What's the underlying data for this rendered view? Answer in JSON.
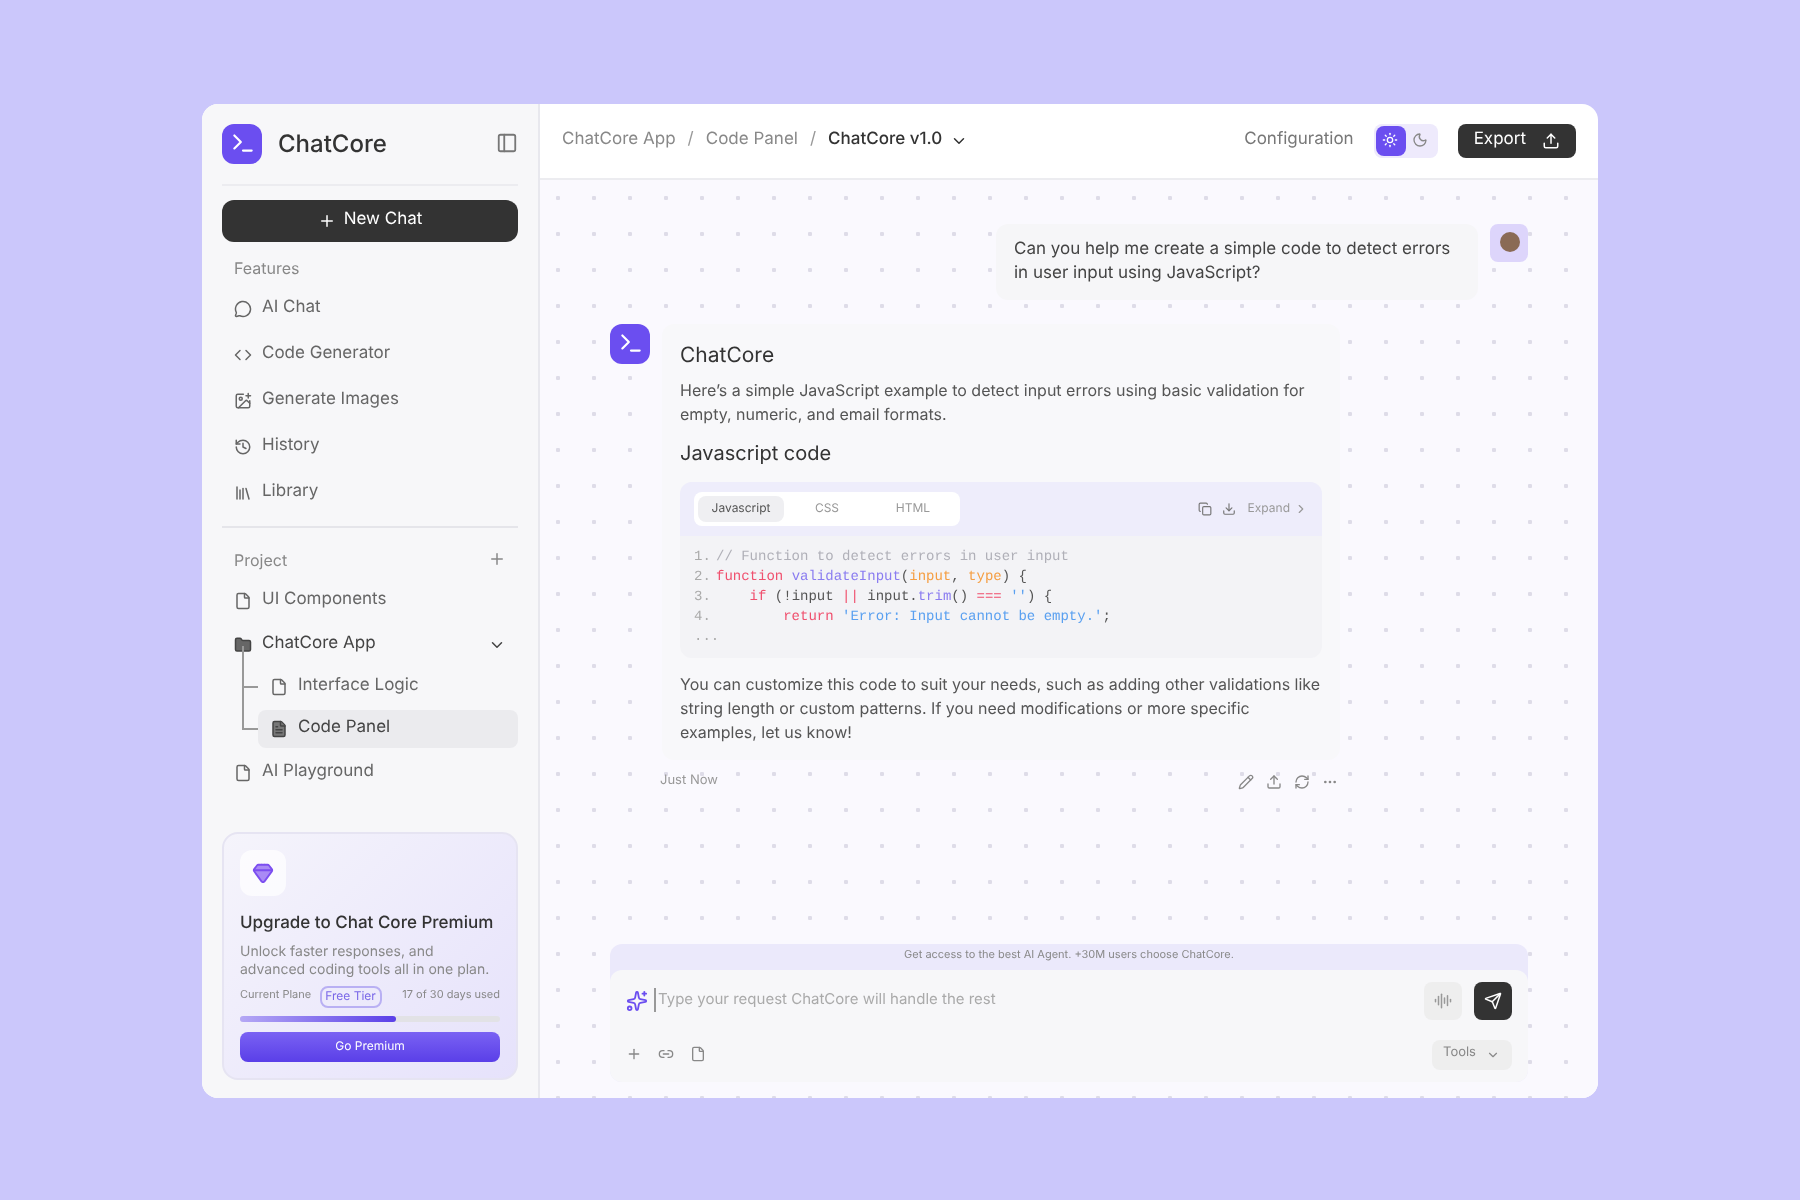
{
  "sidebar": {
    "brand": "ChatCore",
    "new_chat": "New Chat",
    "features_label": "Features",
    "features": [
      {
        "label": "AI Chat"
      },
      {
        "label": "Code Generator"
      },
      {
        "label": "Generate Images"
      },
      {
        "label": "History"
      },
      {
        "label": "Library"
      }
    ],
    "project_label": "Project",
    "projects": [
      {
        "label": "UI Components",
        "selected": false,
        "expanded": false
      },
      {
        "label": "ChatCore App",
        "selected": false,
        "expanded": true,
        "children": [
          {
            "label": "Interface Logic",
            "selected": false
          },
          {
            "label": "Code Panel",
            "selected": true
          }
        ]
      },
      {
        "label": "AI Playground",
        "selected": false,
        "expanded": false
      }
    ],
    "upgrade": {
      "title": "Upgrade to Chat Core Premium",
      "text": "Unlock faster responses, and advanced coding tools all in one plan.",
      "plan_label": "Current Plane",
      "plan": "Free Tier",
      "usage": "17 of 30 days used",
      "level": 0.6,
      "button": "Go Premium"
    }
  },
  "header": {
    "breadcrumbs": [
      "ChatCore App",
      "Code Panel",
      "ChatCore v1.0"
    ],
    "separators": [
      "/",
      "/"
    ],
    "config": "Configuration",
    "theme": [
      {
        "kind": "light",
        "selected": true
      },
      {
        "kind": "dark",
        "selected": false
      }
    ],
    "export": "Export"
  },
  "chat": {
    "user_message": "Can you help me create a simple code to detect errors in user input using JavaScript?",
    "reply": {
      "name": "ChatCore",
      "intro": "Here’s a simple JavaScript example to detect input errors using basic validation for empty, numeric, and email formats.",
      "code_title": "Javascript code",
      "tabs": [
        {
          "label": "Javascript",
          "selected": true
        },
        {
          "label": "CSS",
          "selected": false
        },
        {
          "label": "HTML",
          "selected": false
        }
      ],
      "expand": "Expand",
      "code": [
        {
          "number": "1.",
          "tokens": [
            {
              "kind": "comment",
              "text": "// Function to detect errors in user input"
            }
          ]
        },
        {
          "number": "2.",
          "tokens": [
            {
              "kind": "keyword",
              "text": "function "
            },
            {
              "kind": "fn",
              "text": "validateInput"
            },
            {
              "kind": "plain",
              "text": "("
            },
            {
              "kind": "param",
              "text": "input"
            },
            {
              "kind": "plain",
              "text": ", "
            },
            {
              "kind": "param",
              "text": "type"
            },
            {
              "kind": "plain",
              "text": ") {"
            }
          ]
        },
        {
          "number": "3.",
          "tokens": [
            {
              "kind": "keyword",
              "text": "    if"
            },
            {
              "kind": "plain",
              "text": " (!input "
            },
            {
              "kind": "keyword",
              "text": "||"
            },
            {
              "kind": "plain",
              "text": " input."
            },
            {
              "kind": "fn",
              "text": "trim"
            },
            {
              "kind": "plain",
              "text": "() "
            },
            {
              "kind": "keyword",
              "text": "==="
            },
            {
              "kind": "string",
              "text": " ''"
            },
            {
              "kind": "plain",
              "text": ") {"
            }
          ]
        },
        {
          "number": "4.",
          "tokens": [
            {
              "kind": "keyword",
              "text": "        return "
            },
            {
              "kind": "string",
              "text": "'Error: Input cannot be empty.'"
            },
            {
              "kind": "plain",
              "text": ";"
            }
          ]
        }
      ],
      "ellipsis": "...",
      "outro": "You can customize this code to suit your needs, such as adding other validations like string length or custom patterns. If you need modifications or more specific examples, let us know!",
      "time": "Just Now"
    }
  },
  "composer": {
    "banner": "Get access to the best AI Agent. +30M users choose ChatCore.",
    "placeholder": "Type your request ChatCore will handle the rest",
    "tools": "Tools"
  }
}
